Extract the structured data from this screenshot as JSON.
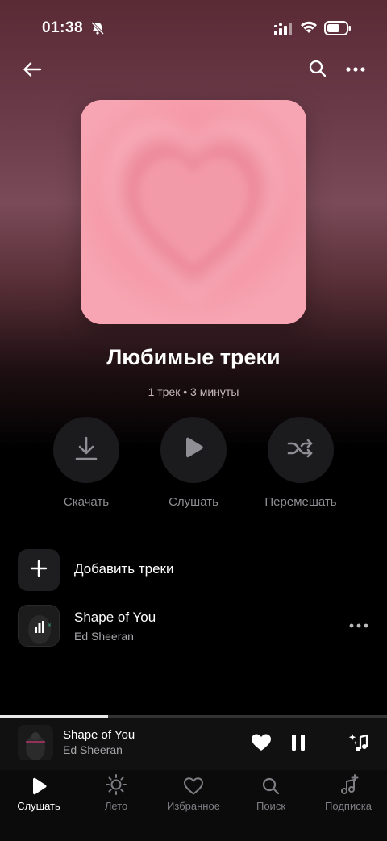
{
  "status_bar": {
    "time": "01:38"
  },
  "playlist": {
    "title": "Любимые треки",
    "meta": "1 трек • 3 минуты"
  },
  "actions": [
    {
      "label": "Скачать",
      "icon": "download-icon"
    },
    {
      "label": "Слушать",
      "icon": "play-icon"
    },
    {
      "label": "Перемешать",
      "icon": "shuffle-icon"
    }
  ],
  "add_tracks": {
    "label": "Добавить треки"
  },
  "tracks": [
    {
      "title": "Shape of You",
      "artist": "Ed Sheeran"
    }
  ],
  "mini_player": {
    "title": "Shape of You",
    "artist": "Ed Sheeran",
    "progress": 0.28
  },
  "tabs": [
    {
      "label": "Слушать",
      "icon": "play-icon",
      "active": true
    },
    {
      "label": "Лето",
      "icon": "sun-icon",
      "active": false
    },
    {
      "label": "Избранное",
      "icon": "heart-icon",
      "active": false
    },
    {
      "label": "Поиск",
      "icon": "search-icon",
      "active": false
    },
    {
      "label": "Подписка",
      "icon": "music-plus-icon",
      "active": false
    }
  ],
  "colors": {
    "background": "#000000",
    "cover_pink": "#ef8f9e",
    "header_gradient": "#6a3a48",
    "muted_text": "#8d8d92"
  }
}
